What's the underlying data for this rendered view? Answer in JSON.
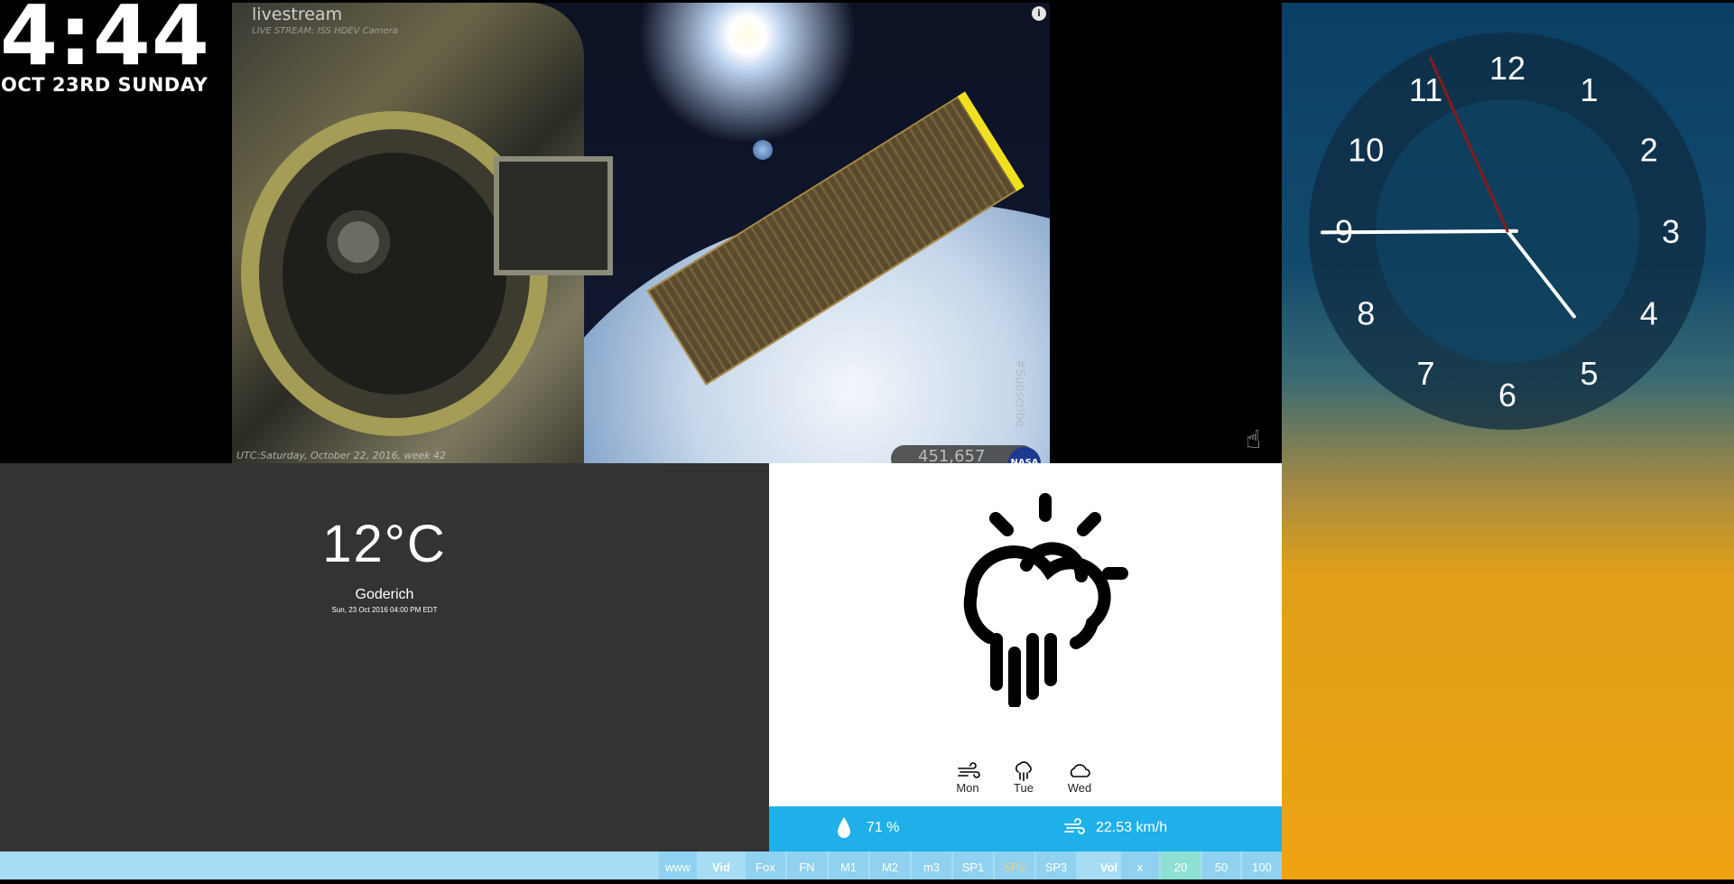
{
  "clock_text": {
    "time": "4:44",
    "date": "OCT 23RD SUNDAY"
  },
  "video": {
    "logo": "livestream",
    "subtitle": "LIVE STREAM: ISS HDEV Camera",
    "utc": "UTC:Saturday, October 22, 2016, week 42",
    "view_count": "451,657",
    "channel_badge": "NASA",
    "subscribe": "#Subscribe",
    "info_icon": "i"
  },
  "analog_clock": {
    "numbers": [
      "12",
      "1",
      "2",
      "3",
      "4",
      "5",
      "6",
      "7",
      "8",
      "9",
      "10",
      "11"
    ],
    "hour": 4,
    "minute": 44,
    "second": 56,
    "face_color": "#0f2c42",
    "second_hand_color": "#8b1a1a"
  },
  "temperature": {
    "value": "12°C",
    "city": "Goderich",
    "updated": "Sun, 23 Oct 2016 04:00 PM EDT"
  },
  "weather": {
    "current_icon": "partly-sunny-rain-icon",
    "forecast": [
      {
        "day": "Mon",
        "icon": "wind-icon"
      },
      {
        "day": "Tue",
        "icon": "rain-icon"
      },
      {
        "day": "Wed",
        "icon": "cloud-icon"
      }
    ],
    "humidity": "71 %",
    "wind": "22.53 km/h",
    "bar_color": "#1fb0ea"
  },
  "bottom_bar": {
    "www": "www",
    "vid_label": "Vid",
    "channels": [
      "Fox",
      "FN",
      "M1",
      "M2",
      "m3",
      "SP1",
      "SP2",
      "SP3"
    ],
    "active_channel": "SP2",
    "vol_label": "Vol",
    "vol_options": [
      "x",
      "20",
      "50",
      "100"
    ],
    "selected_vol": "20"
  }
}
